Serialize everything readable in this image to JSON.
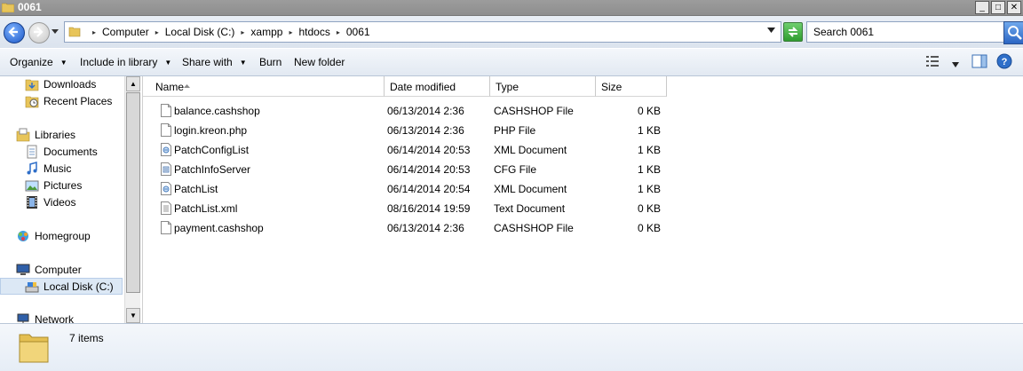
{
  "window": {
    "title": "0061"
  },
  "address": {
    "crumbs": [
      "Computer",
      "Local Disk (C:)",
      "xampp",
      "htdocs",
      "0061"
    ]
  },
  "search": {
    "placeholder": "Search 0061"
  },
  "toolbar": {
    "organize": "Organize",
    "include_in_library": "Include in library",
    "share_with": "Share with",
    "burn": "Burn",
    "new_folder": "New folder"
  },
  "nav": {
    "downloads": "Downloads",
    "recent_places": "Recent Places",
    "libraries": "Libraries",
    "documents": "Documents",
    "music": "Music",
    "pictures": "Pictures",
    "videos": "Videos",
    "homegroup": "Homegroup",
    "computer": "Computer",
    "local_disk": "Local Disk (C:)",
    "network": "Network"
  },
  "columns": {
    "name": "Name",
    "date_modified": "Date modified",
    "type": "Type",
    "size": "Size"
  },
  "files": [
    {
      "name": "balance.cashshop",
      "date": "06/13/2014 2:36",
      "type": "CASHSHOP File",
      "size": "0 KB",
      "icon": "blank-file-icon"
    },
    {
      "name": "login.kreon.php",
      "date": "06/13/2014 2:36",
      "type": "PHP File",
      "size": "1 KB",
      "icon": "php-file-icon"
    },
    {
      "name": "PatchConfigList",
      "date": "06/14/2014 20:53",
      "type": "XML Document",
      "size": "1 KB",
      "icon": "xml-file-icon"
    },
    {
      "name": "PatchInfoServer",
      "date": "06/14/2014 20:53",
      "type": "CFG File",
      "size": "1 KB",
      "icon": "cfg-file-icon"
    },
    {
      "name": "PatchList",
      "date": "06/14/2014 20:54",
      "type": "XML Document",
      "size": "1 KB",
      "icon": "xml-file-icon"
    },
    {
      "name": "PatchList.xml",
      "date": "08/16/2014 19:59",
      "type": "Text Document",
      "size": "0 KB",
      "icon": "text-file-icon"
    },
    {
      "name": "payment.cashshop",
      "date": "06/13/2014 2:36",
      "type": "CASHSHOP File",
      "size": "0 KB",
      "icon": "blank-file-icon"
    }
  ],
  "status": {
    "item_count": "7 items"
  }
}
